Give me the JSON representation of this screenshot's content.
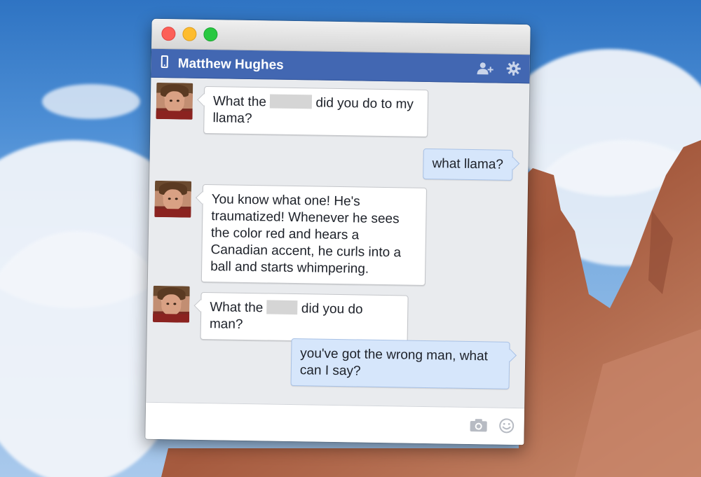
{
  "chat": {
    "contact_name": "Matthew Hughes"
  },
  "messages": [
    {
      "from": "contact",
      "parts": [
        "What the ",
        " did you do to my llama?"
      ],
      "censored": true
    },
    {
      "from": "me",
      "text": "what llama?"
    },
    {
      "from": "contact",
      "text": "You know what one! He's traumatized! Whenever he sees the color red and hears a Canadian accent, he curls into a ball and starts whimpering."
    },
    {
      "from": "contact",
      "parts": [
        "What the ",
        " did you do man?"
      ],
      "censored": true
    },
    {
      "from": "me",
      "text": "you've got the wrong man, what can I say?"
    }
  ],
  "icons": {
    "phone": "phone-icon",
    "add_friends": "add-friends-icon",
    "settings": "gear-icon",
    "camera": "camera-icon",
    "emoji": "smiley-icon"
  },
  "colors": {
    "header_bg": "#4267b2",
    "outgoing_bubble": "#d6e6fb",
    "incoming_bubble": "#ffffff"
  }
}
